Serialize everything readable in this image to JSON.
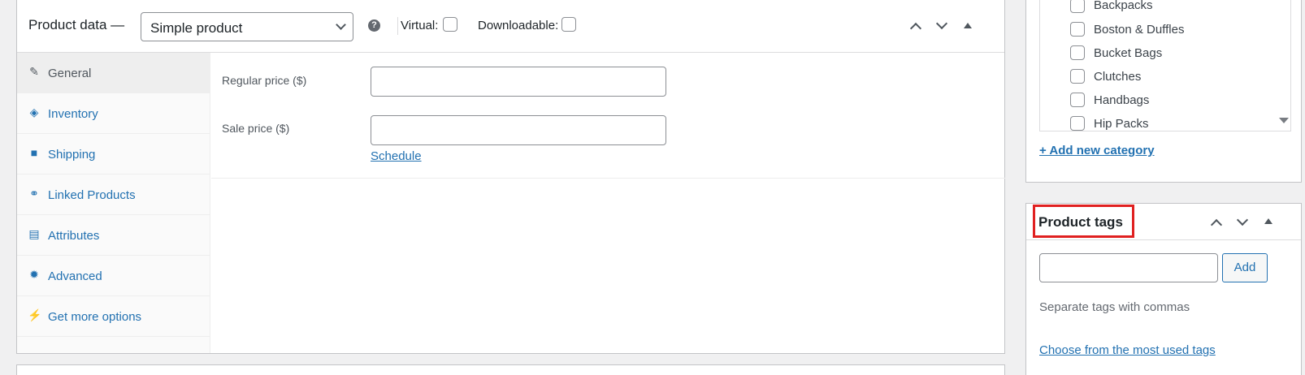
{
  "product_data": {
    "title": "Product data —",
    "product_type": "Simple product",
    "help_icon": "?",
    "virtual_label": "Virtual:",
    "downloadable_label": "Downloadable:"
  },
  "tabs": [
    {
      "label": "General",
      "icon": "wrench-icon",
      "glyph": "✎",
      "active": true
    },
    {
      "label": "Inventory",
      "icon": "tag-icon",
      "glyph": "◈",
      "active": false
    },
    {
      "label": "Shipping",
      "icon": "truck-icon",
      "glyph": "■",
      "active": false
    },
    {
      "label": "Linked Products",
      "icon": "link-icon",
      "glyph": "⚭",
      "active": false
    },
    {
      "label": "Attributes",
      "icon": "list-icon",
      "glyph": "▤",
      "active": false
    },
    {
      "label": "Advanced",
      "icon": "gear-icon",
      "glyph": "✹",
      "active": false
    },
    {
      "label": "Get more options",
      "icon": "plugin-icon",
      "glyph": "⚡",
      "active": false
    }
  ],
  "general": {
    "regular_price_label": "Regular price ($)",
    "regular_price_value": "",
    "sale_price_label": "Sale price ($)",
    "sale_price_value": "",
    "schedule_link": "Schedule"
  },
  "categories": {
    "items": [
      "Backpacks",
      "Boston & Duffles",
      "Bucket Bags",
      "Clutches",
      "Handbags",
      "Hip Packs"
    ],
    "add_new_link": "+ Add new category"
  },
  "tags": {
    "title": "Product tags",
    "input_value": "",
    "add_button": "Add",
    "hint": "Separate tags with commas",
    "most_used_link": "Choose from the most used tags"
  },
  "colors": {
    "link": "#2271b1",
    "highlight": "#e02020"
  }
}
